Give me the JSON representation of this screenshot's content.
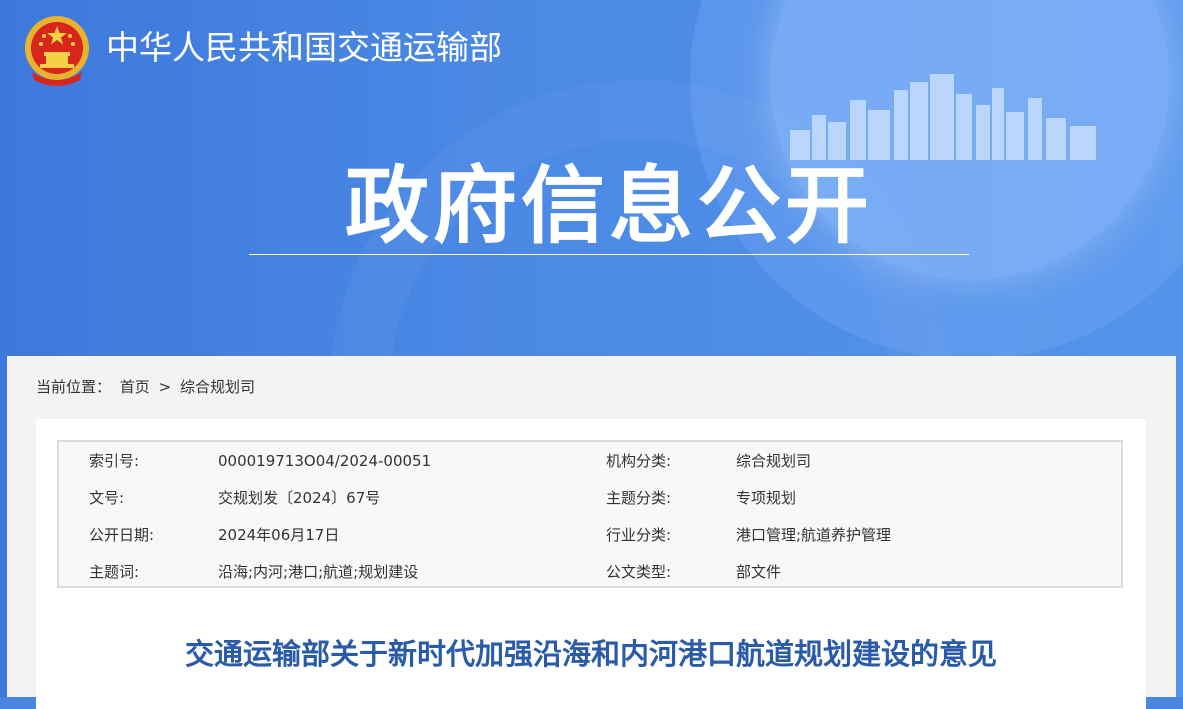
{
  "header": {
    "ministry_name": "中华人民共和国交通运输部",
    "section_title": "政府信息公开"
  },
  "breadcrumb": {
    "prefix": "当前位置：",
    "home": "首页",
    "separator": ">",
    "current": "综合规划司"
  },
  "metadata": {
    "rows": [
      {
        "label1": "索引号:",
        "value1": "000019713O04/2024-00051",
        "label2": "机构分类:",
        "value2": "综合规划司"
      },
      {
        "label1": "文号:",
        "value1": "交规划发〔2024〕67号",
        "label2": "主题分类:",
        "value2": "专项规划"
      },
      {
        "label1": "公开日期:",
        "value1": "2024年06月17日",
        "label2": "行业分类:",
        "value2": "港口管理;航道养护管理"
      },
      {
        "label1": "主题词:",
        "value1": "沿海;内河;港口;航道;规划建设",
        "label2": "公文类型:",
        "value2": "部文件"
      }
    ]
  },
  "document": {
    "title": "交通运输部关于新时代加强沿海和内河港口航道规划建设的意见"
  },
  "colors": {
    "banner": "#4a86e0",
    "title_blue": "#2a5ba8",
    "content_bg": "#f3f3f3"
  },
  "icons": {
    "emblem": "national-emblem-icon"
  }
}
